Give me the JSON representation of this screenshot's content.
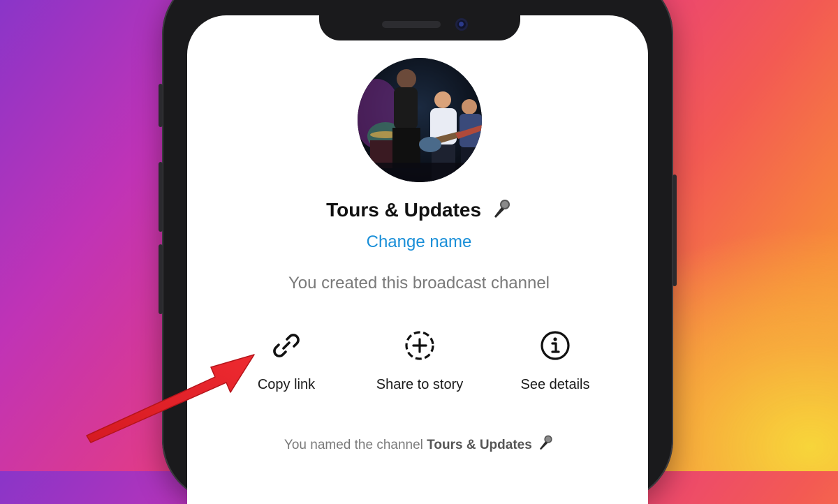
{
  "channel": {
    "name": "Tours & Updates",
    "change_name_label": "Change name",
    "created_text": "You created this broadcast channel"
  },
  "actions": [
    {
      "label": "Copy link",
      "icon": "link-icon"
    },
    {
      "label": "Share to story",
      "icon": "add-story-icon"
    },
    {
      "label": "See details",
      "icon": "info-icon"
    }
  ],
  "system_message": {
    "prefix": "You named the channel",
    "channel_name": "Tours & Updates"
  },
  "colors": {
    "accent_link": "#1a8fd8",
    "annotation_arrow": "#e8232a"
  }
}
